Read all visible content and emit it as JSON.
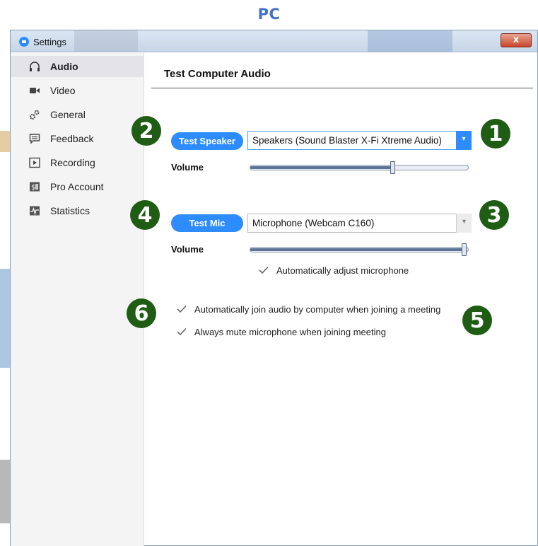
{
  "page_heading": "PC",
  "window": {
    "title": "Settings",
    "close_symbol": "x"
  },
  "sidebar": {
    "items": [
      {
        "label": "Audio",
        "icon": "headphones-icon",
        "active": true
      },
      {
        "label": "Video",
        "icon": "video-camera-icon",
        "active": false
      },
      {
        "label": "General",
        "icon": "gears-icon",
        "active": false
      },
      {
        "label": "Feedback",
        "icon": "chat-bubble-icon",
        "active": false
      },
      {
        "label": "Recording",
        "icon": "play-box-icon",
        "active": false
      },
      {
        "label": "Pro Account",
        "icon": "dollar-card-icon",
        "active": false
      },
      {
        "label": "Statistics",
        "icon": "pulse-icon",
        "active": false
      }
    ]
  },
  "main": {
    "section_title": "Test Computer Audio",
    "speaker": {
      "test_button": "Test Speaker",
      "device": "Speakers (Sound Blaster X-Fi Xtreme Audio)",
      "volume_label": "Volume",
      "volume_level": 0.66
    },
    "mic": {
      "test_button": "Test Mic",
      "device": "Microphone (Webcam C160)",
      "volume_label": "Volume",
      "volume_level": 1.0,
      "auto_adjust_label": "Automatically adjust microphone",
      "auto_adjust_checked": true
    },
    "options": [
      {
        "label": "Automatically join audio by computer when joining a meeting",
        "checked": true
      },
      {
        "label": "Always mute microphone when joining meeting",
        "checked": true
      }
    ]
  },
  "callouts": [
    "1",
    "2",
    "3",
    "4",
    "5",
    "6"
  ],
  "colors": {
    "accent": "#2d8cff",
    "callout": "#1f5c14",
    "heading": "#4472c4"
  }
}
